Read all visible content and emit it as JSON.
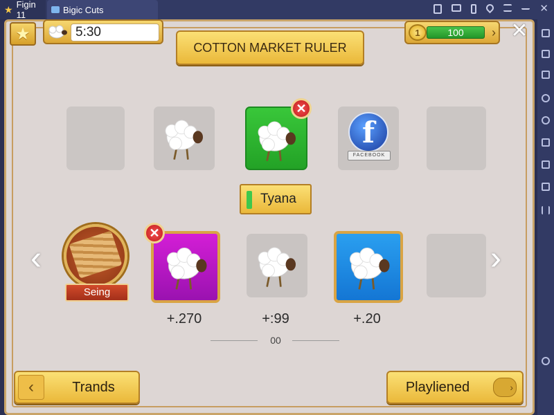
{
  "emulator": {
    "tabs": [
      {
        "label": "Figin 11",
        "icon": "star-icon"
      },
      {
        "label": "Bigic Cuts",
        "icon": "image-icon"
      }
    ],
    "controls": [
      "notes-icon",
      "keyboard-icon",
      "bookmark-icon",
      "location-icon",
      "menu-icon",
      "minimize-icon",
      "close-icon"
    ],
    "sidebar_icons": [
      "fullscreen-icon",
      "chart-icon",
      "edit-icon",
      "location-icon",
      "rotate-icon",
      "camera-icon",
      "folder-icon",
      "grid-icon",
      "pause-icon",
      "settings-icon"
    ]
  },
  "hud": {
    "timer": "5:30",
    "title": "COTTON MARKET RULER",
    "coin_level": "1",
    "coins": "100"
  },
  "top_row": [
    {
      "type": "empty"
    },
    {
      "type": "sheep"
    },
    {
      "type": "sheep",
      "color": "green",
      "removable": true
    },
    {
      "type": "facebook",
      "icon": "f",
      "ribbon": "FACEBOOK"
    },
    {
      "type": "empty"
    }
  ],
  "name_tag": "Tyana",
  "bottom_row": [
    {
      "type": "medal",
      "label": "Seing"
    },
    {
      "type": "sheep",
      "color": "purple",
      "removable": true,
      "price": "+.270"
    },
    {
      "type": "sheep",
      "price": "+:99"
    },
    {
      "type": "sheep",
      "color": "blue",
      "price": "+.20"
    },
    {
      "type": "empty"
    }
  ],
  "pager": "00",
  "buttons": {
    "left": "Trands",
    "right": "Playliened"
  },
  "colors": {
    "panel_bg": "#ddd6d4",
    "gold": "#eab83a",
    "green_tile": "#23a226",
    "purple_tile": "#9a12b0",
    "blue_tile": "#1476d4",
    "badge_red": "#c01c1c"
  }
}
